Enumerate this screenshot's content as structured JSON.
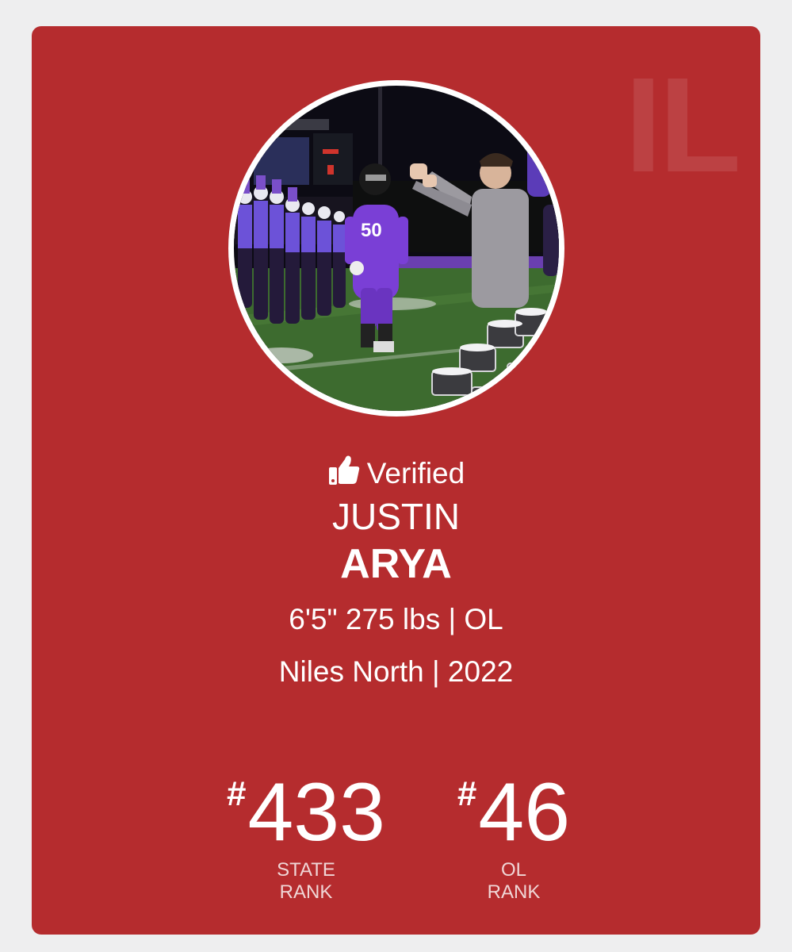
{
  "card": {
    "state_abbrev": "IL",
    "background_color": "#b52c2e",
    "verified_label": "Verified",
    "verified_icon": "thumbs-up-icon",
    "player": {
      "first_name": "JUSTIN",
      "last_name": "ARYA",
      "measurements": "6'5\" 275 lbs | OL",
      "school_class": "Niles North | 2022",
      "photo": "player-profile-photo"
    },
    "ranks": [
      {
        "hash": "#",
        "value": "433",
        "label_line1": "STATE",
        "label_line2": "RANK"
      },
      {
        "hash": "#",
        "value": "46",
        "label_line1": "OL",
        "label_line2": "RANK"
      }
    ]
  }
}
